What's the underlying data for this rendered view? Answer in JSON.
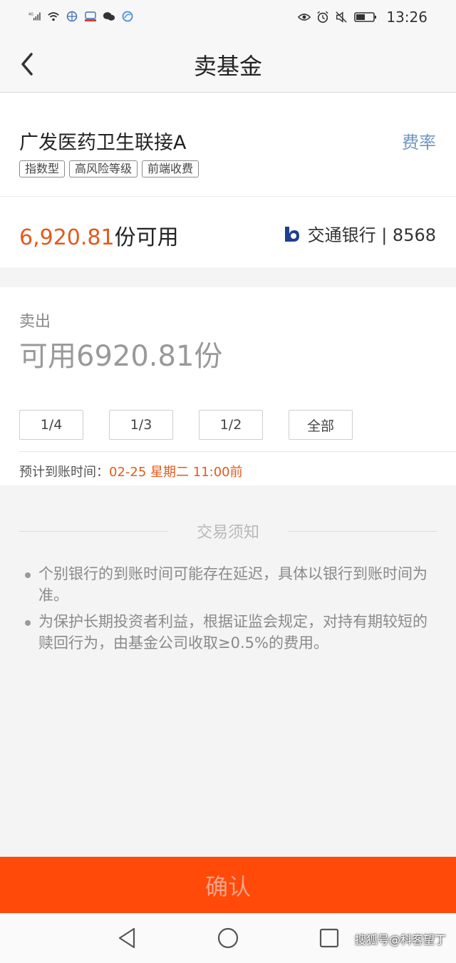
{
  "status_bar": {
    "network": "4G",
    "time": "13:26"
  },
  "header": {
    "title": "卖基金"
  },
  "fund": {
    "name": "广发医药卫生联接A",
    "fee_link": "费率",
    "tags": [
      "指数型",
      "高风险等级",
      "前端收费"
    ]
  },
  "balance": {
    "amount": "6,920.81",
    "unit_text": "份可用",
    "bank": "交通银行 | 8568"
  },
  "sell": {
    "label": "卖出",
    "placeholder": "可用6920.81份",
    "fractions": [
      "1/4",
      "1/3",
      "1/2",
      "全部"
    ],
    "arrival_label": "预计到账时间：",
    "arrival_time": "02-25 星期二 11:00前"
  },
  "notice": {
    "title": "交易须知",
    "items": [
      "个别银行的到账时间可能存在延迟，具体以银行到账时间为准。",
      "为保护长期投资者利益，根据证监会规定，对持有期较短的赎回行为，由基金公司收取≥0.5%的费用。"
    ]
  },
  "confirm_label": "确认",
  "watermark": "搜狐号@科客望丁",
  "colors": {
    "accent_orange": "#e35a1d",
    "confirm_bg": "#ff4a0a",
    "link_blue": "#6f95c0"
  }
}
